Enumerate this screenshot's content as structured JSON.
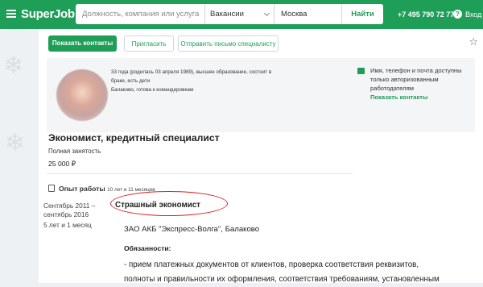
{
  "header": {
    "logo": "SuperJob",
    "search_placeholder": "Должность, компания или услуга",
    "category_value": "Вакансии",
    "city_value": "Москва",
    "find_label": "Найти",
    "phone": "+7 495 790 72 77",
    "help_label": "?",
    "login_label": "Вход"
  },
  "actions": {
    "show_contacts_label": "Показать контакты",
    "invite_label": "Пригласить",
    "send_letter_label": "Отправить письмо специалисту"
  },
  "profile": {
    "info_line1": "33 года (родилась 03 апреля 1989), высшее образование, состоит в браке, есть дети",
    "info_line2": "Балаково, готова к командировкам"
  },
  "contacts_note": {
    "text": "Имя, телефон и почта доступны только авторизованным работодателям",
    "link": "Показать контакты"
  },
  "resume": {
    "title": "Экономист, кредитный специалист",
    "employment": "Полная занятость",
    "salary": "25 000 ₽"
  },
  "experience": {
    "heading": "Опыт работы",
    "total": "10 лет и 11 месяцев",
    "period_line1": "Сентябрь 2011 –",
    "period_line2": "сентябрь 2016",
    "duration": "5 лет и 1 месяц",
    "job_title": "Страшный экономист",
    "company": "ЗАО АКБ \"Экспресс-Волга\", Балаково",
    "duties_heading": "Обязанности:",
    "duties_line1": "- прием платежных документов от клиентов, проверка соответствия реквизитов,",
    "duties_line2": "полноты и правильности их оформления, соответствия требованиям, установленным"
  },
  "colors": {
    "brand_green": "#1e9e57",
    "highlight_red": "#d62020"
  }
}
